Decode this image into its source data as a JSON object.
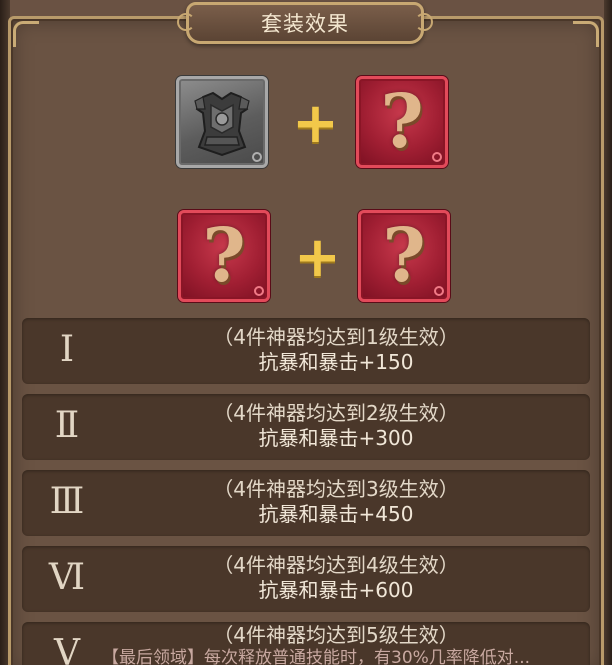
{
  "title": "套装效果",
  "slots": [
    {
      "state": "equipped",
      "icon": "armor-icon"
    },
    {
      "state": "unknown",
      "icon": "question-mark-icon",
      "glyph": "?"
    },
    {
      "state": "unknown",
      "icon": "question-mark-icon",
      "glyph": "?"
    },
    {
      "state": "unknown",
      "icon": "question-mark-icon",
      "glyph": "?"
    }
  ],
  "plus_glyph": "+",
  "tiers": [
    {
      "numeral": "Ⅰ",
      "condition": "（4件神器均达到1级生效）",
      "effect": "抗暴和暴击+150"
    },
    {
      "numeral": "Ⅱ",
      "condition": "（4件神器均达到2级生效）",
      "effect": "抗暴和暴击+300"
    },
    {
      "numeral": "Ⅲ",
      "condition": "（4件神器均达到3级生效）",
      "effect": "抗暴和暴击+450"
    },
    {
      "numeral": "Ⅵ",
      "condition": "（4件神器均达到4级生效）",
      "effect": "抗暴和暴击+600"
    },
    {
      "numeral": "Ⅴ",
      "condition": "（4件神器均达到5级生效）",
      "effect": "【最后领域】每次释放普通技能时，有30%几率降低对..."
    }
  ],
  "colors": {
    "panel_bg": "#6a5343",
    "border_gold": "#c8a872",
    "tier_bg": "#4a372a",
    "unknown_red": "#a11f33",
    "plus_gold": "#f2c84a"
  }
}
